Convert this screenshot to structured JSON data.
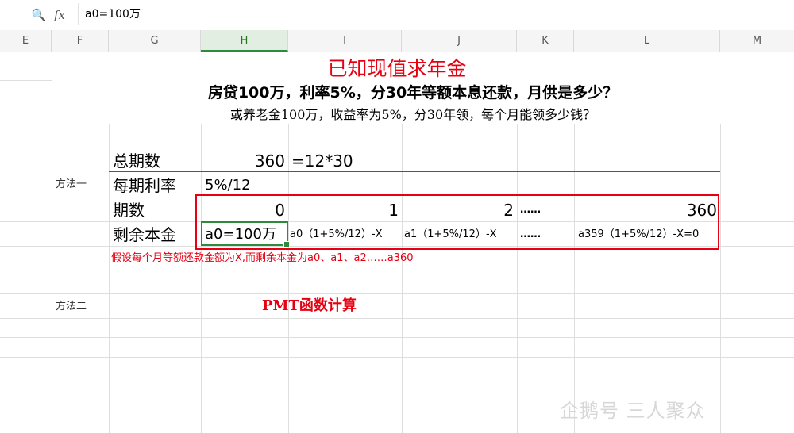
{
  "formula_bar": {
    "zoom_icon": "zoom-icon",
    "fx_label": "fx",
    "value": "a0=100万"
  },
  "columns": [
    "E",
    "F",
    "G",
    "H",
    "I",
    "J",
    "K",
    "L",
    "M"
  ],
  "selected_column": "H",
  "sheet": {
    "title": "已知现值求年金",
    "subtitle1": "房贷100万，利率5%，分30年等额本息还款，月供是多少？",
    "subtitle2": "或养老金100万，收益率为5%，分30年领，每个月能领多少钱？",
    "method1_label": "方法一",
    "total_periods_label": "总期数",
    "total_periods_value": "360",
    "total_periods_formula": "=12*30",
    "rate_label": "每期利率",
    "rate_value": "5%/12",
    "period_label": "期数",
    "periods": [
      "0",
      "1",
      "2",
      "……",
      "360"
    ],
    "principal_label": "剩余本金",
    "principals": [
      "a0=100万",
      "a0（1+5%/12）-X",
      "a1（1+5%/12）-X",
      "……",
      "a359（1+5%/12）-X=0"
    ],
    "note": "假设每个月等额还款金额为X,而剩余本金为a0、a1、a2……a360",
    "method2_label": "方法二",
    "pmt_text": "PMT函数计算"
  },
  "watermark": "企鹅号 三人聚众",
  "colors": {
    "accent_red": "#e60012",
    "selection_green": "#2e8b3e"
  }
}
